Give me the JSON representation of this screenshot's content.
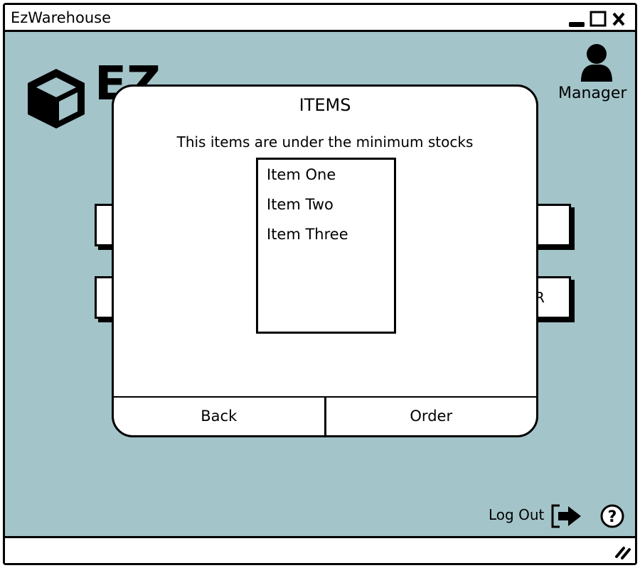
{
  "window": {
    "title": "EzWarehouse"
  },
  "header": {
    "logo_text": "EZ",
    "user_label": "Manager"
  },
  "background": {
    "partial_button_text": "R"
  },
  "modal": {
    "title": "ITEMS",
    "message": "This items are under the minimum stocks",
    "items": [
      "Item One",
      "Item Two",
      "Item Three"
    ],
    "back_label": "Back",
    "order_label": "Order"
  },
  "footer": {
    "logout_label": "Log Out"
  },
  "colors": {
    "background": "#a3c4c9"
  }
}
